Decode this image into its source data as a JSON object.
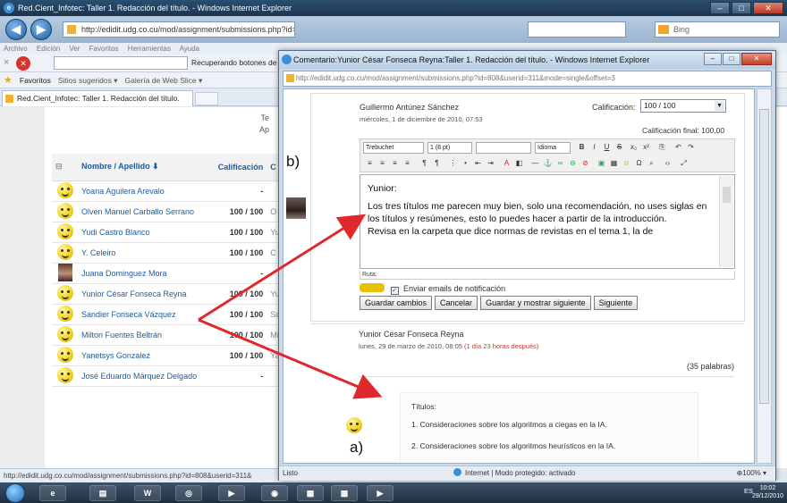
{
  "main_window": {
    "title": "Red.Cient_Infotec: Taller 1. Redacción del título. - Windows Internet Explorer",
    "address": "http://edidit.udg.co.cu/mod/assignment/submissions.php?id=808",
    "search_placeholder": "Bing",
    "menu": [
      "Archivo",
      "Edición",
      "Ver",
      "Favoritos",
      "Herramientas",
      "Ayuda"
    ],
    "loading_status": "Recuperando botones de",
    "favorites_label": "Favoritos",
    "favorites_items": [
      "Sitios sugeridos ▾",
      "Galería de Web Slice ▾"
    ],
    "tab_title": "Red.Cient_Infotec: Taller 1. Redacción del título.",
    "status_url": "http://edidit.udg.co.cu/mod/assignment/submissions.php?id=808&userid=311&",
    "assignment_info_lines": [
      "Te",
      "Ap"
    ]
  },
  "grades_table": {
    "col_name": "Nombre / Apellido ⬇",
    "col_grade": "Calificación",
    "col_comment": "C",
    "rows": [
      {
        "name": "Yoana Aguilera Arevalo",
        "grade": "-",
        "avatar": "smiley",
        "tail": ""
      },
      {
        "name": "Olven Manuel Carballo Serrano",
        "grade": "100 / 100",
        "avatar": "smiley",
        "tail": "O"
      },
      {
        "name": "Yudi Castro Blanco",
        "grade": "100 / 100",
        "avatar": "smiley",
        "tail": "Yu"
      },
      {
        "name": "Y. Celeiro",
        "grade": "100 / 100",
        "avatar": "smiley",
        "tail": "C"
      },
      {
        "name": "Juana Dominguez Mora",
        "grade": "-",
        "avatar": "photo",
        "tail": ""
      },
      {
        "name": "Yunior César Fonseca Reyna",
        "grade": "100 / 100",
        "avatar": "smiley",
        "tail": "Yu"
      },
      {
        "name": "Sandier Fonseca Vázquez",
        "grade": "100 / 100",
        "avatar": "smiley",
        "tail": "Sa"
      },
      {
        "name": "Milton Fuentes Beltrán",
        "grade": "100 / 100",
        "avatar": "smiley",
        "tail": "Mi"
      },
      {
        "name": "Yanetsys Gonzalez",
        "grade": "100 / 100",
        "avatar": "smiley",
        "tail": "Ya"
      },
      {
        "name": "José Eduardo Márquez Delgado",
        "grade": "-",
        "avatar": "smiley",
        "tail": ""
      }
    ]
  },
  "popup": {
    "title": "Comentario:Yunior César Fonseca Reyna:Taller 1. Redacción del título. - Windows Internet Explorer",
    "address": "http://edidit.udg.co.cu/mod/assignment/submissions.php?id=808&userid=311&mode=single&offset=3",
    "teacher_name": "Guillermo Antúnez Sánchez",
    "teacher_date": "miércoles, 1 de diciembre de 2010, 07:53",
    "grade_label": "Calificación:",
    "grade_value": "100 / 100",
    "final_grade": "Calificación final: 100,00",
    "toolbar_font": "Trebuchet",
    "toolbar_size": "1 (8 pt)",
    "toolbar_lang": "Idioma",
    "feedback_greeting": "Yunior:",
    "feedback_p1": "Los tres títulos me parecen muy bien, solo una recomendación, no uses siglas en los títulos y resúmenes, esto lo puedes hacer a partir de la introducción.",
    "feedback_p2": "Revisa en la carpeta que dice normas de revistas en el tema 1, la de",
    "path_label": "Ruta:",
    "notify_label": "Enviar emails de notificación",
    "btn_save": "Guardar cambios",
    "btn_cancel": "Cancelar",
    "btn_save_next": "Guardar y mostrar siguiente",
    "btn_next": "Siguiente",
    "student_name": "Yunior César Fonseca Reyna",
    "submission_date": "lunes, 29 de marzo de 2010, 08:05",
    "late_note": "(1 día 23 horas después)",
    "word_count": "(35 palabras)",
    "sub_heading": "Títulos:",
    "sub_item1": "1. Consideraciones sobre los algoritmos a ciegas en la  IA.",
    "sub_item2": "2. Consideraciones sobre los algoritmos heurísticos en la IA.",
    "status_ready": "Listo",
    "status_zone": "Internet | Modo protegido: activado",
    "status_zoom": "⊕100% ▾"
  },
  "annotations": {
    "label_b": "b)",
    "label_a": "a)"
  },
  "taskbar": {
    "tray_text": "ES",
    "clock_time": "10:02",
    "clock_date": "29/12/2010"
  },
  "colors": {
    "link_blue": "#1f5a99",
    "arrow_red": "#e0282c",
    "late_red": "#c0392b"
  }
}
